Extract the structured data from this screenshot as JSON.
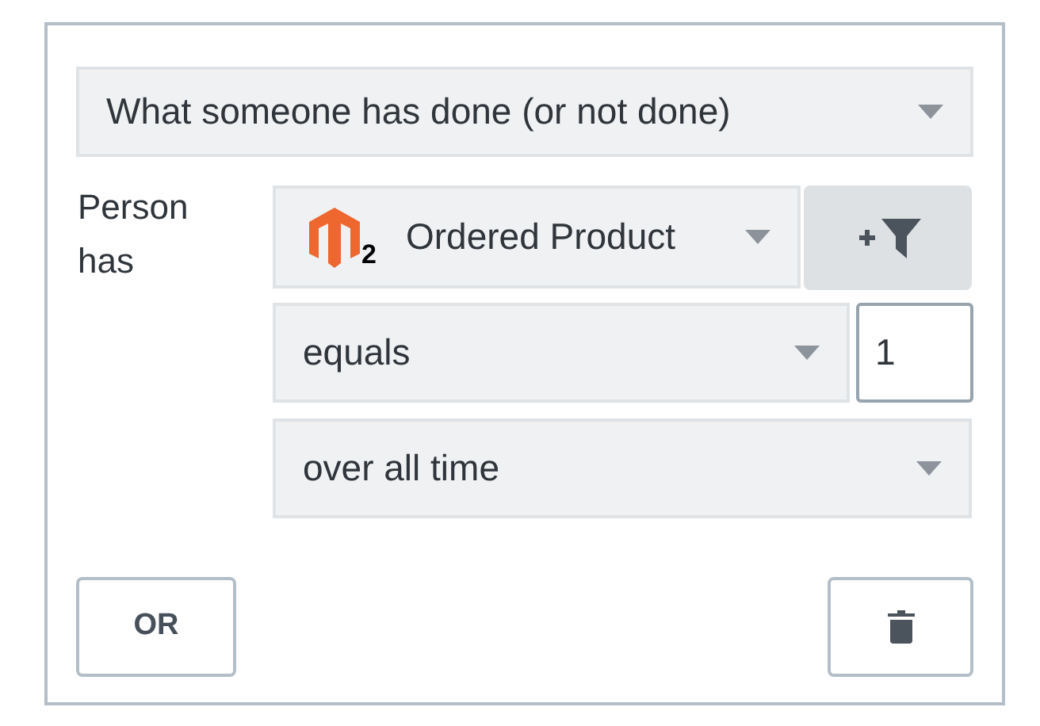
{
  "type_select": {
    "value": "What someone has done (or not done)"
  },
  "condition": {
    "label": "Person has",
    "event": {
      "value": "Ordered Product",
      "logo_badge": "2"
    },
    "operator": {
      "value": "equals"
    },
    "count": {
      "value": "1"
    },
    "timeframe": {
      "value": "over all time"
    }
  },
  "or_button": {
    "label": "OR"
  }
}
